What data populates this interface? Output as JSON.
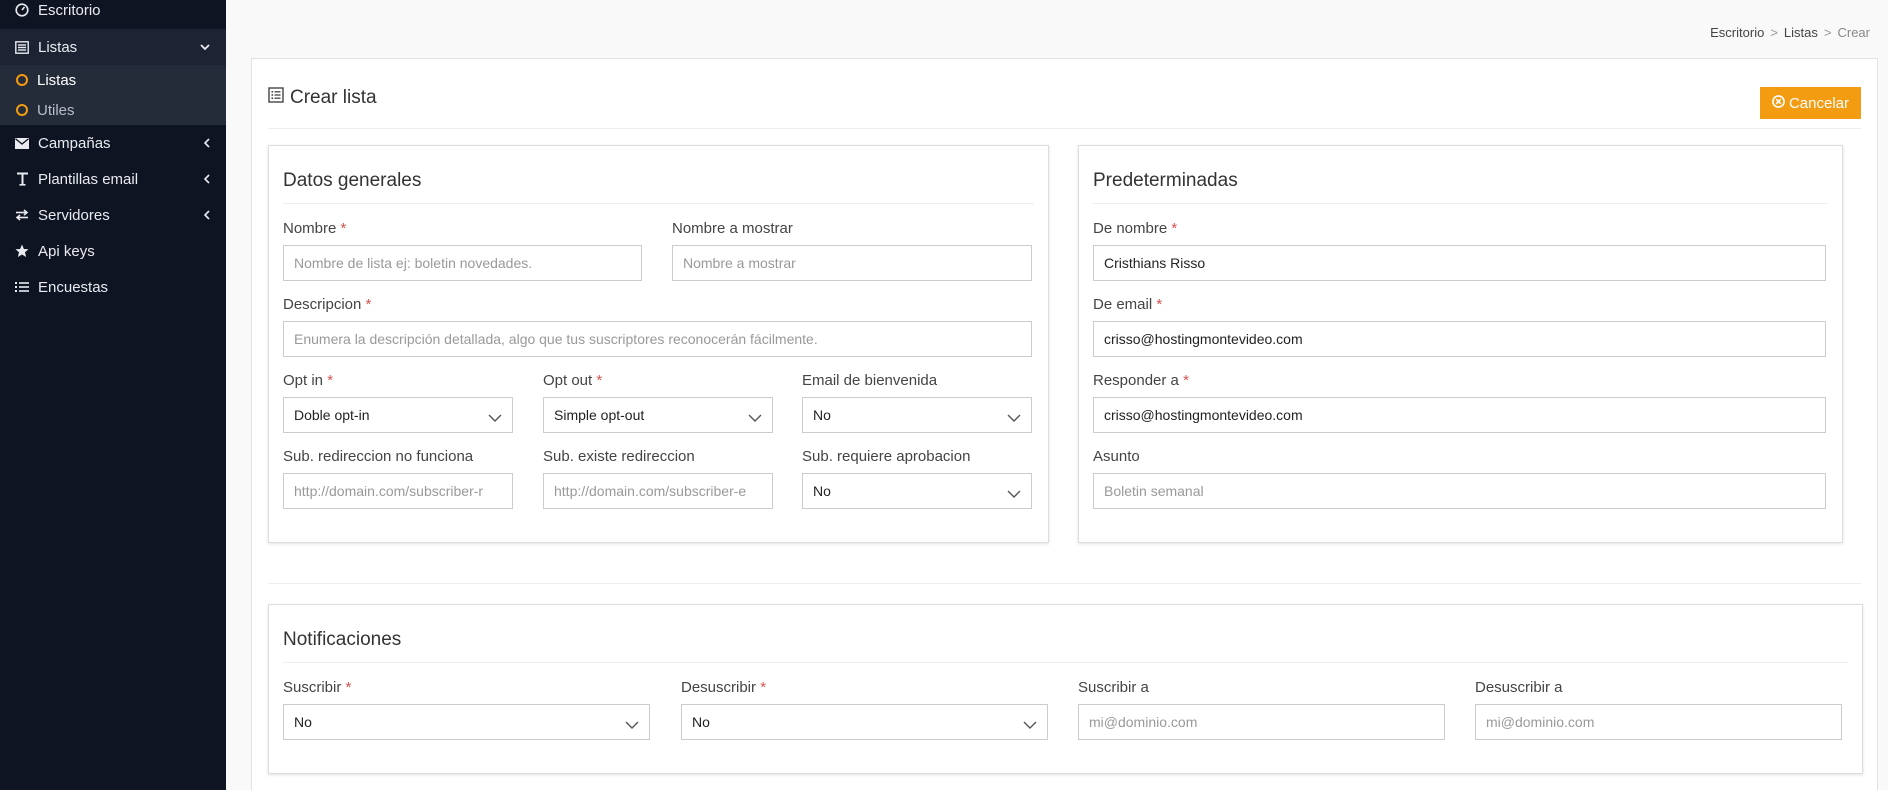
{
  "sidebar": {
    "items": [
      {
        "label": "Escritorio",
        "icon": "dashboard-icon"
      },
      {
        "label": "Listas",
        "icon": "list-alt-icon"
      },
      {
        "label": "Campañas",
        "icon": "envelope-icon"
      },
      {
        "label": "Plantillas email",
        "icon": "text-icon"
      },
      {
        "label": "Servidores",
        "icon": "exchange-icon"
      },
      {
        "label": "Api keys",
        "icon": "star-icon"
      },
      {
        "label": "Encuestas",
        "icon": "list-icon"
      }
    ],
    "submenu": [
      {
        "label": "Listas"
      },
      {
        "label": "Utiles"
      }
    ]
  },
  "breadcrumb": {
    "items": [
      "Escritorio",
      "Listas",
      "Crear"
    ],
    "separator": ">"
  },
  "page": {
    "title": "Crear lista",
    "cancel_label": "Cancelar"
  },
  "general": {
    "title": "Datos generales",
    "nombre": {
      "label": "Nombre",
      "placeholder": "Nombre de lista  ej: boletin novedades."
    },
    "nombre_mostrar": {
      "label": "Nombre a mostrar",
      "placeholder": "Nombre a mostrar"
    },
    "descripcion": {
      "label": "Descripcion",
      "placeholder": "Enumera la descripción detallada, algo que tus suscriptores reconocerán fácilmente."
    },
    "opt_in": {
      "label": "Opt in",
      "value": "Doble opt-in"
    },
    "opt_out": {
      "label": "Opt out",
      "value": "Simple opt-out"
    },
    "email_bienvenida": {
      "label": "Email de bienvenida",
      "value": "No"
    },
    "redir_no_funciona": {
      "label": "Sub. redireccion no funciona",
      "placeholder": "http://domain.com/subscriber-r"
    },
    "existe_redir": {
      "label": "Sub. existe redireccion",
      "placeholder": "http://domain.com/subscriber-e"
    },
    "requiere_aprobacion": {
      "label": "Sub. requiere aprobacion",
      "value": "No"
    }
  },
  "defaults": {
    "title": "Predeterminadas",
    "de_nombre": {
      "label": "De nombre",
      "value": "Cristhians Risso"
    },
    "de_email": {
      "label": "De email",
      "value": "crisso@hostingmontevideo.com"
    },
    "responder_a": {
      "label": "Responder a",
      "value": "crisso@hostingmontevideo.com"
    },
    "asunto": {
      "label": "Asunto",
      "placeholder": "Boletin semanal"
    }
  },
  "notifications": {
    "title": "Notificaciones",
    "suscribir": {
      "label": "Suscribir",
      "value": "No"
    },
    "desuscribir": {
      "label": "Desuscribir",
      "value": "No"
    },
    "suscribir_a": {
      "label": "Suscribir a",
      "placeholder": "mi@dominio.com"
    },
    "desuscribir_a": {
      "label": "Desuscribir a",
      "placeholder": "mi@dominio.com"
    }
  },
  "required_mark": "*",
  "colors": {
    "sidebar_bg": "#0f1422",
    "accent": "#f39c12",
    "required": "#d9534f"
  }
}
